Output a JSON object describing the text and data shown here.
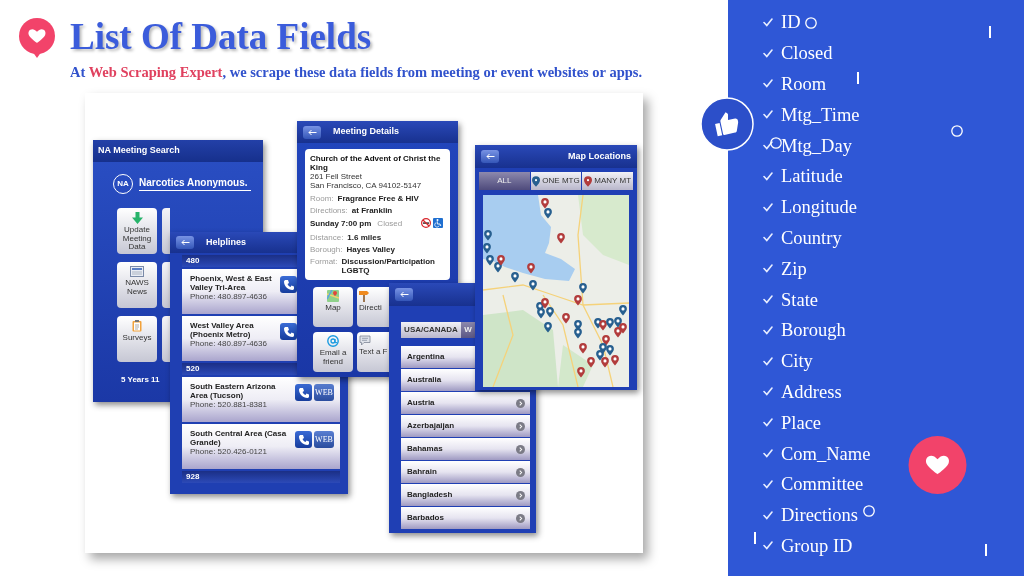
{
  "header": {
    "title": "List Of Data Fields",
    "subtitle": {
      "before": "At",
      "highlight": "Web Scraping Expert",
      "after": ", we scrape these data fields from meeting or event websites or apps."
    }
  },
  "collage": {
    "home": {
      "title": "NA Meeting Search",
      "logo": {
        "mark": "NA",
        "name": "Narcotics Anonymous."
      },
      "tiles": [
        "Update Meeting Data",
        "NAWS News",
        "Surveys"
      ],
      "footer": "5 Years 11"
    },
    "helplines": {
      "title": "Helplines",
      "sections": [
        {
          "code": "480",
          "entries": [
            {
              "name": "Phoenix, West & East Valley Tri-Area",
              "phone": "Phone: 480.897-4636"
            },
            {
              "name": "West Valley Area (Phoenix Metro)",
              "phone": "Phone: 480.897-4636"
            }
          ]
        },
        {
          "code": "520",
          "entries": [
            {
              "name": "South Eastern Arizona Area (Tucson)",
              "phone": "Phone: 520.881-8381",
              "web": "WEB"
            },
            {
              "name": "South Central Area (Casa Grande)",
              "phone": "Phone: 520.426-0121",
              "web": "WEB"
            }
          ]
        },
        {
          "code": "928"
        }
      ]
    },
    "meeting": {
      "title": "Meeting Details",
      "place": "Church of the Advent of Christ the King",
      "address": [
        "261 Fell Street",
        "San Francisco, CA 94102-5147"
      ],
      "rows": [
        {
          "label": "Room:",
          "value": "Fragrance Free & HIV"
        },
        {
          "label": "Directions:",
          "value": "at Franklin"
        }
      ],
      "time": "Sunday 7:00 pm",
      "type": "Closed",
      "info": [
        {
          "label": "Distance:",
          "value": "1.6 miles"
        },
        {
          "label": "Borough:",
          "value": "Hayes Valley"
        },
        {
          "label": "Format:",
          "value": "Discussion/Participation LGBTQ"
        }
      ],
      "tiles": [
        "Map",
        "Directi",
        "Email a friend",
        "Text a F"
      ]
    },
    "countries": {
      "tabs": [
        {
          "label": "USA/CANADA",
          "selected": false
        },
        {
          "label": "W",
          "selected": true
        }
      ],
      "items": [
        "Argentina",
        "Australia",
        "Austria",
        "Azerbajaijan",
        "Bahamas",
        "Bahrain",
        "Bangladesh",
        "Barbados"
      ]
    },
    "map": {
      "title": "Map Locations",
      "tabs": [
        {
          "label": "ALL",
          "selected": true
        },
        {
          "label": "ONE MTG",
          "selected": false,
          "color": "#275f8f"
        },
        {
          "label": "MANY MT",
          "selected": false,
          "color": "#b23c3c"
        }
      ]
    }
  },
  "fields": [
    "ID",
    "Closed",
    "Room",
    "Mtg_Time",
    "Mtg_Day",
    "Latitude",
    "Longitude",
    "Country",
    "Zip",
    "State",
    "Borough",
    "City",
    "Address",
    "Place",
    "Com_Name",
    "Committee",
    "Directions",
    "Group ID"
  ]
}
